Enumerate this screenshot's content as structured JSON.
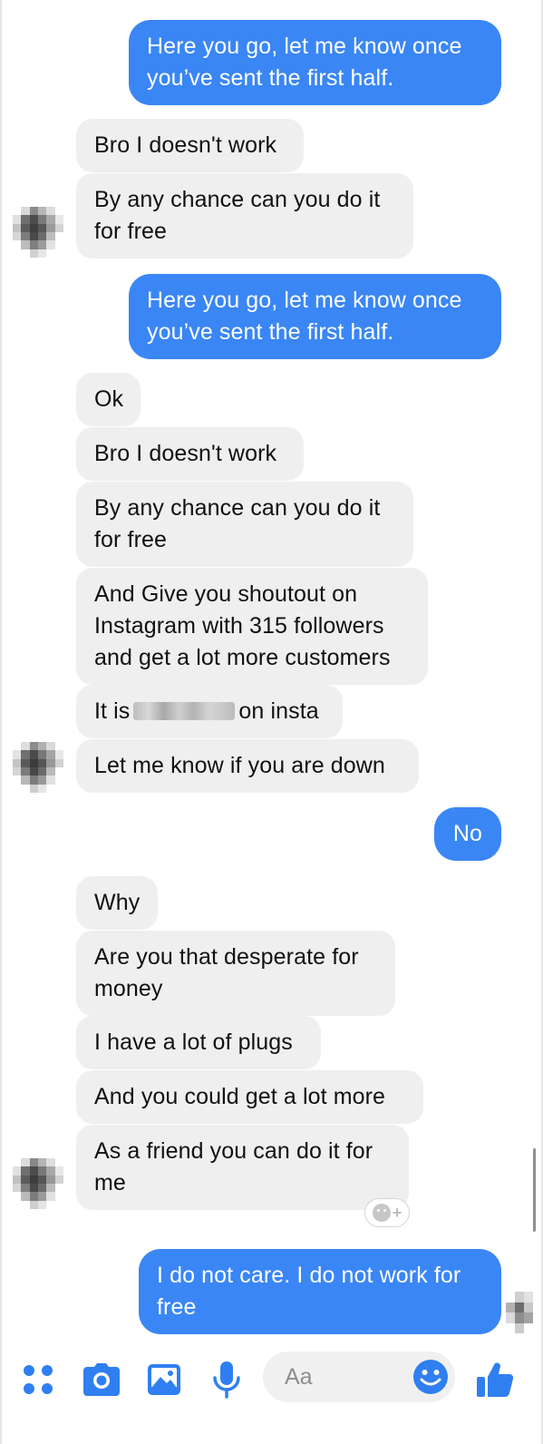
{
  "conversation": {
    "messages": [
      {
        "side": "out",
        "text": "Here you go, let me know once\nyou’ve sent the first half."
      },
      {
        "side": "in",
        "text": "Bro I doesn't work"
      },
      {
        "side": "in",
        "text": "By any chance can you do it\nfor free"
      },
      {
        "side": "out",
        "text": "Here you go, let me know once\nyou’ve sent the first half."
      },
      {
        "side": "in",
        "text": "Ok"
      },
      {
        "side": "in",
        "text": "Bro I doesn't work"
      },
      {
        "side": "in",
        "text": "By any chance can you do it\nfor free"
      },
      {
        "side": "in",
        "text": "And Give you shoutout on\nInstagram with 315 followers\nand get a lot more customers"
      },
      {
        "side": "in",
        "text_before": "It is",
        "text_after": "on insta",
        "redacted": true
      },
      {
        "side": "in",
        "text": "Let me know if you are down"
      },
      {
        "side": "out",
        "text": "No"
      },
      {
        "side": "in",
        "text": "Why"
      },
      {
        "side": "in",
        "text": "Are you that desperate for\nmoney"
      },
      {
        "side": "in",
        "text": "I have a lot of plugs"
      },
      {
        "side": "in",
        "text": "And you could get a lot more"
      },
      {
        "side": "in",
        "text": "As a friend you can do it for\nme"
      },
      {
        "side": "out",
        "text": "I do not care. I do not work for\nfree"
      }
    ]
  },
  "composer": {
    "placeholder": "Aa",
    "icons": [
      "more-apps-icon",
      "camera-icon",
      "gallery-icon",
      "microphone-icon",
      "emoji-icon",
      "thumbs-up-icon"
    ]
  },
  "colors": {
    "outgoing_bubble": "#3a86f5",
    "incoming_bubble": "#efefef",
    "accent": "#2f7ff0"
  }
}
